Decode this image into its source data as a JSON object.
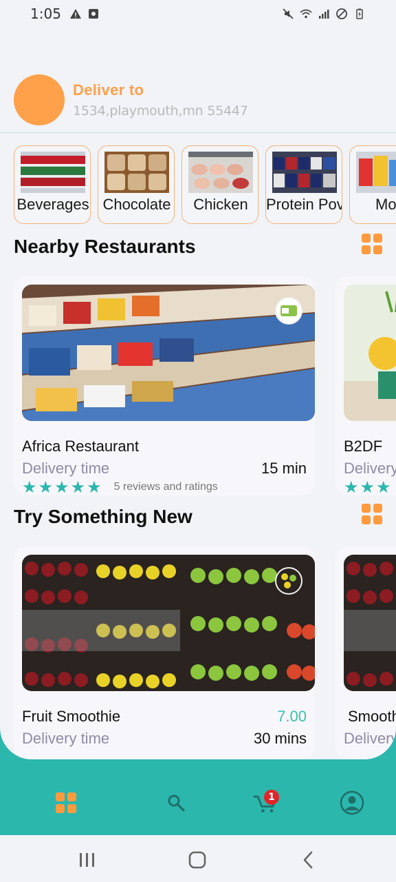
{
  "status": {
    "time": "1:05"
  },
  "header": {
    "deliver_title": "Deliver to",
    "address": "1534,playmouth,mn 55447"
  },
  "categories": [
    {
      "label": "Beverages"
    },
    {
      "label": "Chocolate"
    },
    {
      "label": "Chicken"
    },
    {
      "label": "Protein Pov"
    },
    {
      "label": "Mor"
    }
  ],
  "sections": {
    "nearby": {
      "title": "Nearby Restaurants",
      "cards": [
        {
          "name": "Africa Restaurant",
          "delivery_label": "Delivery time",
          "time": "15 min",
          "reviews": "5 reviews and ratings",
          "stars": 5
        },
        {
          "name": "B2DF",
          "delivery_label": "Delivery time"
        }
      ]
    },
    "try_new": {
      "title": "Try Something New",
      "cards": [
        {
          "name": "Fruit Smoothie",
          "price": "7.00",
          "delivery_label": "Delivery time",
          "time": "30 mins"
        },
        {
          "name": "Smoothie",
          "delivery_label": "Delivery time"
        }
      ]
    }
  },
  "bottom_nav": {
    "cart_badge": "1"
  },
  "colors": {
    "accent": "#ffa04a",
    "teal": "#2cb7ad",
    "star": "#2cb7ad"
  }
}
